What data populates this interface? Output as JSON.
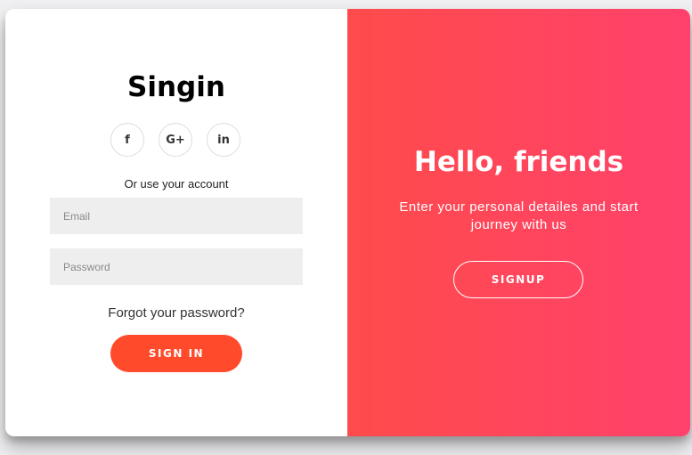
{
  "signin": {
    "title": "Singin",
    "socials": [
      {
        "icon": "facebook-icon",
        "glyph": "f"
      },
      {
        "icon": "google-plus-icon",
        "glyph": "G+"
      },
      {
        "icon": "linkedin-icon",
        "glyph": "in"
      }
    ],
    "or_text": "Or use your account",
    "email_placeholder": "Email",
    "email_value": "",
    "password_placeholder": "Password",
    "password_value": "",
    "forgot_label": "Forgot your password?",
    "signin_label": "SIGN IN"
  },
  "overlay": {
    "title": "Hello, friends",
    "tagline": "Enter your personal detailes and start journey with us",
    "signup_label": "SIGNUP"
  },
  "colors": {
    "accent": "#ff4b2b",
    "gradient_start": "#ff4b4b",
    "gradient_end": "#ff416c"
  }
}
